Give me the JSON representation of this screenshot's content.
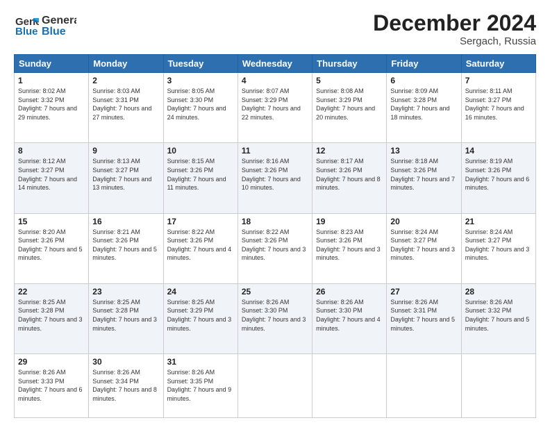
{
  "header": {
    "logo_line1": "General",
    "logo_line2": "Blue",
    "title": "December 2024",
    "subtitle": "Sergach, Russia"
  },
  "days_of_week": [
    "Sunday",
    "Monday",
    "Tuesday",
    "Wednesday",
    "Thursday",
    "Friday",
    "Saturday"
  ],
  "weeks": [
    [
      {
        "day": "1",
        "sunrise": "Sunrise: 8:02 AM",
        "sunset": "Sunset: 3:32 PM",
        "daylight": "Daylight: 7 hours and 29 minutes."
      },
      {
        "day": "2",
        "sunrise": "Sunrise: 8:03 AM",
        "sunset": "Sunset: 3:31 PM",
        "daylight": "Daylight: 7 hours and 27 minutes."
      },
      {
        "day": "3",
        "sunrise": "Sunrise: 8:05 AM",
        "sunset": "Sunset: 3:30 PM",
        "daylight": "Daylight: 7 hours and 24 minutes."
      },
      {
        "day": "4",
        "sunrise": "Sunrise: 8:07 AM",
        "sunset": "Sunset: 3:29 PM",
        "daylight": "Daylight: 7 hours and 22 minutes."
      },
      {
        "day": "5",
        "sunrise": "Sunrise: 8:08 AM",
        "sunset": "Sunset: 3:29 PM",
        "daylight": "Daylight: 7 hours and 20 minutes."
      },
      {
        "day": "6",
        "sunrise": "Sunrise: 8:09 AM",
        "sunset": "Sunset: 3:28 PM",
        "daylight": "Daylight: 7 hours and 18 minutes."
      },
      {
        "day": "7",
        "sunrise": "Sunrise: 8:11 AM",
        "sunset": "Sunset: 3:27 PM",
        "daylight": "Daylight: 7 hours and 16 minutes."
      }
    ],
    [
      {
        "day": "8",
        "sunrise": "Sunrise: 8:12 AM",
        "sunset": "Sunset: 3:27 PM",
        "daylight": "Daylight: 7 hours and 14 minutes."
      },
      {
        "day": "9",
        "sunrise": "Sunrise: 8:13 AM",
        "sunset": "Sunset: 3:27 PM",
        "daylight": "Daylight: 7 hours and 13 minutes."
      },
      {
        "day": "10",
        "sunrise": "Sunrise: 8:15 AM",
        "sunset": "Sunset: 3:26 PM",
        "daylight": "Daylight: 7 hours and 11 minutes."
      },
      {
        "day": "11",
        "sunrise": "Sunrise: 8:16 AM",
        "sunset": "Sunset: 3:26 PM",
        "daylight": "Daylight: 7 hours and 10 minutes."
      },
      {
        "day": "12",
        "sunrise": "Sunrise: 8:17 AM",
        "sunset": "Sunset: 3:26 PM",
        "daylight": "Daylight: 7 hours and 8 minutes."
      },
      {
        "day": "13",
        "sunrise": "Sunrise: 8:18 AM",
        "sunset": "Sunset: 3:26 PM",
        "daylight": "Daylight: 7 hours and 7 minutes."
      },
      {
        "day": "14",
        "sunrise": "Sunrise: 8:19 AM",
        "sunset": "Sunset: 3:26 PM",
        "daylight": "Daylight: 7 hours and 6 minutes."
      }
    ],
    [
      {
        "day": "15",
        "sunrise": "Sunrise: 8:20 AM",
        "sunset": "Sunset: 3:26 PM",
        "daylight": "Daylight: 7 hours and 5 minutes."
      },
      {
        "day": "16",
        "sunrise": "Sunrise: 8:21 AM",
        "sunset": "Sunset: 3:26 PM",
        "daylight": "Daylight: 7 hours and 5 minutes."
      },
      {
        "day": "17",
        "sunrise": "Sunrise: 8:22 AM",
        "sunset": "Sunset: 3:26 PM",
        "daylight": "Daylight: 7 hours and 4 minutes."
      },
      {
        "day": "18",
        "sunrise": "Sunrise: 8:22 AM",
        "sunset": "Sunset: 3:26 PM",
        "daylight": "Daylight: 7 hours and 3 minutes."
      },
      {
        "day": "19",
        "sunrise": "Sunrise: 8:23 AM",
        "sunset": "Sunset: 3:26 PM",
        "daylight": "Daylight: 7 hours and 3 minutes."
      },
      {
        "day": "20",
        "sunrise": "Sunrise: 8:24 AM",
        "sunset": "Sunset: 3:27 PM",
        "daylight": "Daylight: 7 hours and 3 minutes."
      },
      {
        "day": "21",
        "sunrise": "Sunrise: 8:24 AM",
        "sunset": "Sunset: 3:27 PM",
        "daylight": "Daylight: 7 hours and 3 minutes."
      }
    ],
    [
      {
        "day": "22",
        "sunrise": "Sunrise: 8:25 AM",
        "sunset": "Sunset: 3:28 PM",
        "daylight": "Daylight: 7 hours and 3 minutes."
      },
      {
        "day": "23",
        "sunrise": "Sunrise: 8:25 AM",
        "sunset": "Sunset: 3:28 PM",
        "daylight": "Daylight: 7 hours and 3 minutes."
      },
      {
        "day": "24",
        "sunrise": "Sunrise: 8:25 AM",
        "sunset": "Sunset: 3:29 PM",
        "daylight": "Daylight: 7 hours and 3 minutes."
      },
      {
        "day": "25",
        "sunrise": "Sunrise: 8:26 AM",
        "sunset": "Sunset: 3:30 PM",
        "daylight": "Daylight: 7 hours and 3 minutes."
      },
      {
        "day": "26",
        "sunrise": "Sunrise: 8:26 AM",
        "sunset": "Sunset: 3:30 PM",
        "daylight": "Daylight: 7 hours and 4 minutes."
      },
      {
        "day": "27",
        "sunrise": "Sunrise: 8:26 AM",
        "sunset": "Sunset: 3:31 PM",
        "daylight": "Daylight: 7 hours and 5 minutes."
      },
      {
        "day": "28",
        "sunrise": "Sunrise: 8:26 AM",
        "sunset": "Sunset: 3:32 PM",
        "daylight": "Daylight: 7 hours and 5 minutes."
      }
    ],
    [
      {
        "day": "29",
        "sunrise": "Sunrise: 8:26 AM",
        "sunset": "Sunset: 3:33 PM",
        "daylight": "Daylight: 7 hours and 6 minutes."
      },
      {
        "day": "30",
        "sunrise": "Sunrise: 8:26 AM",
        "sunset": "Sunset: 3:34 PM",
        "daylight": "Daylight: 7 hours and 8 minutes."
      },
      {
        "day": "31",
        "sunrise": "Sunrise: 8:26 AM",
        "sunset": "Sunset: 3:35 PM",
        "daylight": "Daylight: 7 hours and 9 minutes."
      },
      null,
      null,
      null,
      null
    ]
  ]
}
